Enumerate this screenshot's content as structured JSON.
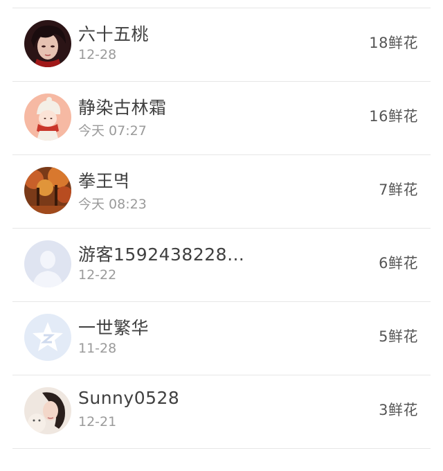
{
  "rows": [
    {
      "name": "六十五桃",
      "date": "12-28",
      "flowers": "18鲜花",
      "avatar_icon": "anime-man-avatar-icon"
    },
    {
      "name": "静染古林霜",
      "date": "今天 07:27",
      "flowers": "16鲜花",
      "avatar_icon": "winter-girl-avatar-icon"
    },
    {
      "name": "拳王멱",
      "date": "今天 08:23",
      "flowers": "7鲜花",
      "avatar_icon": "autumn-forest-avatar-icon"
    },
    {
      "name": "游客1592438228…",
      "date": "12-22",
      "flowers": "6鲜花",
      "avatar_icon": "default-user-avatar-icon"
    },
    {
      "name": "一世繁华",
      "date": "11-28",
      "flowers": "5鲜花",
      "avatar_icon": "qzone-star-avatar-icon"
    },
    {
      "name": "Sunny0528",
      "date": "12-21",
      "flowers": "3鲜花",
      "avatar_icon": "girl-photo-avatar-icon"
    }
  ]
}
